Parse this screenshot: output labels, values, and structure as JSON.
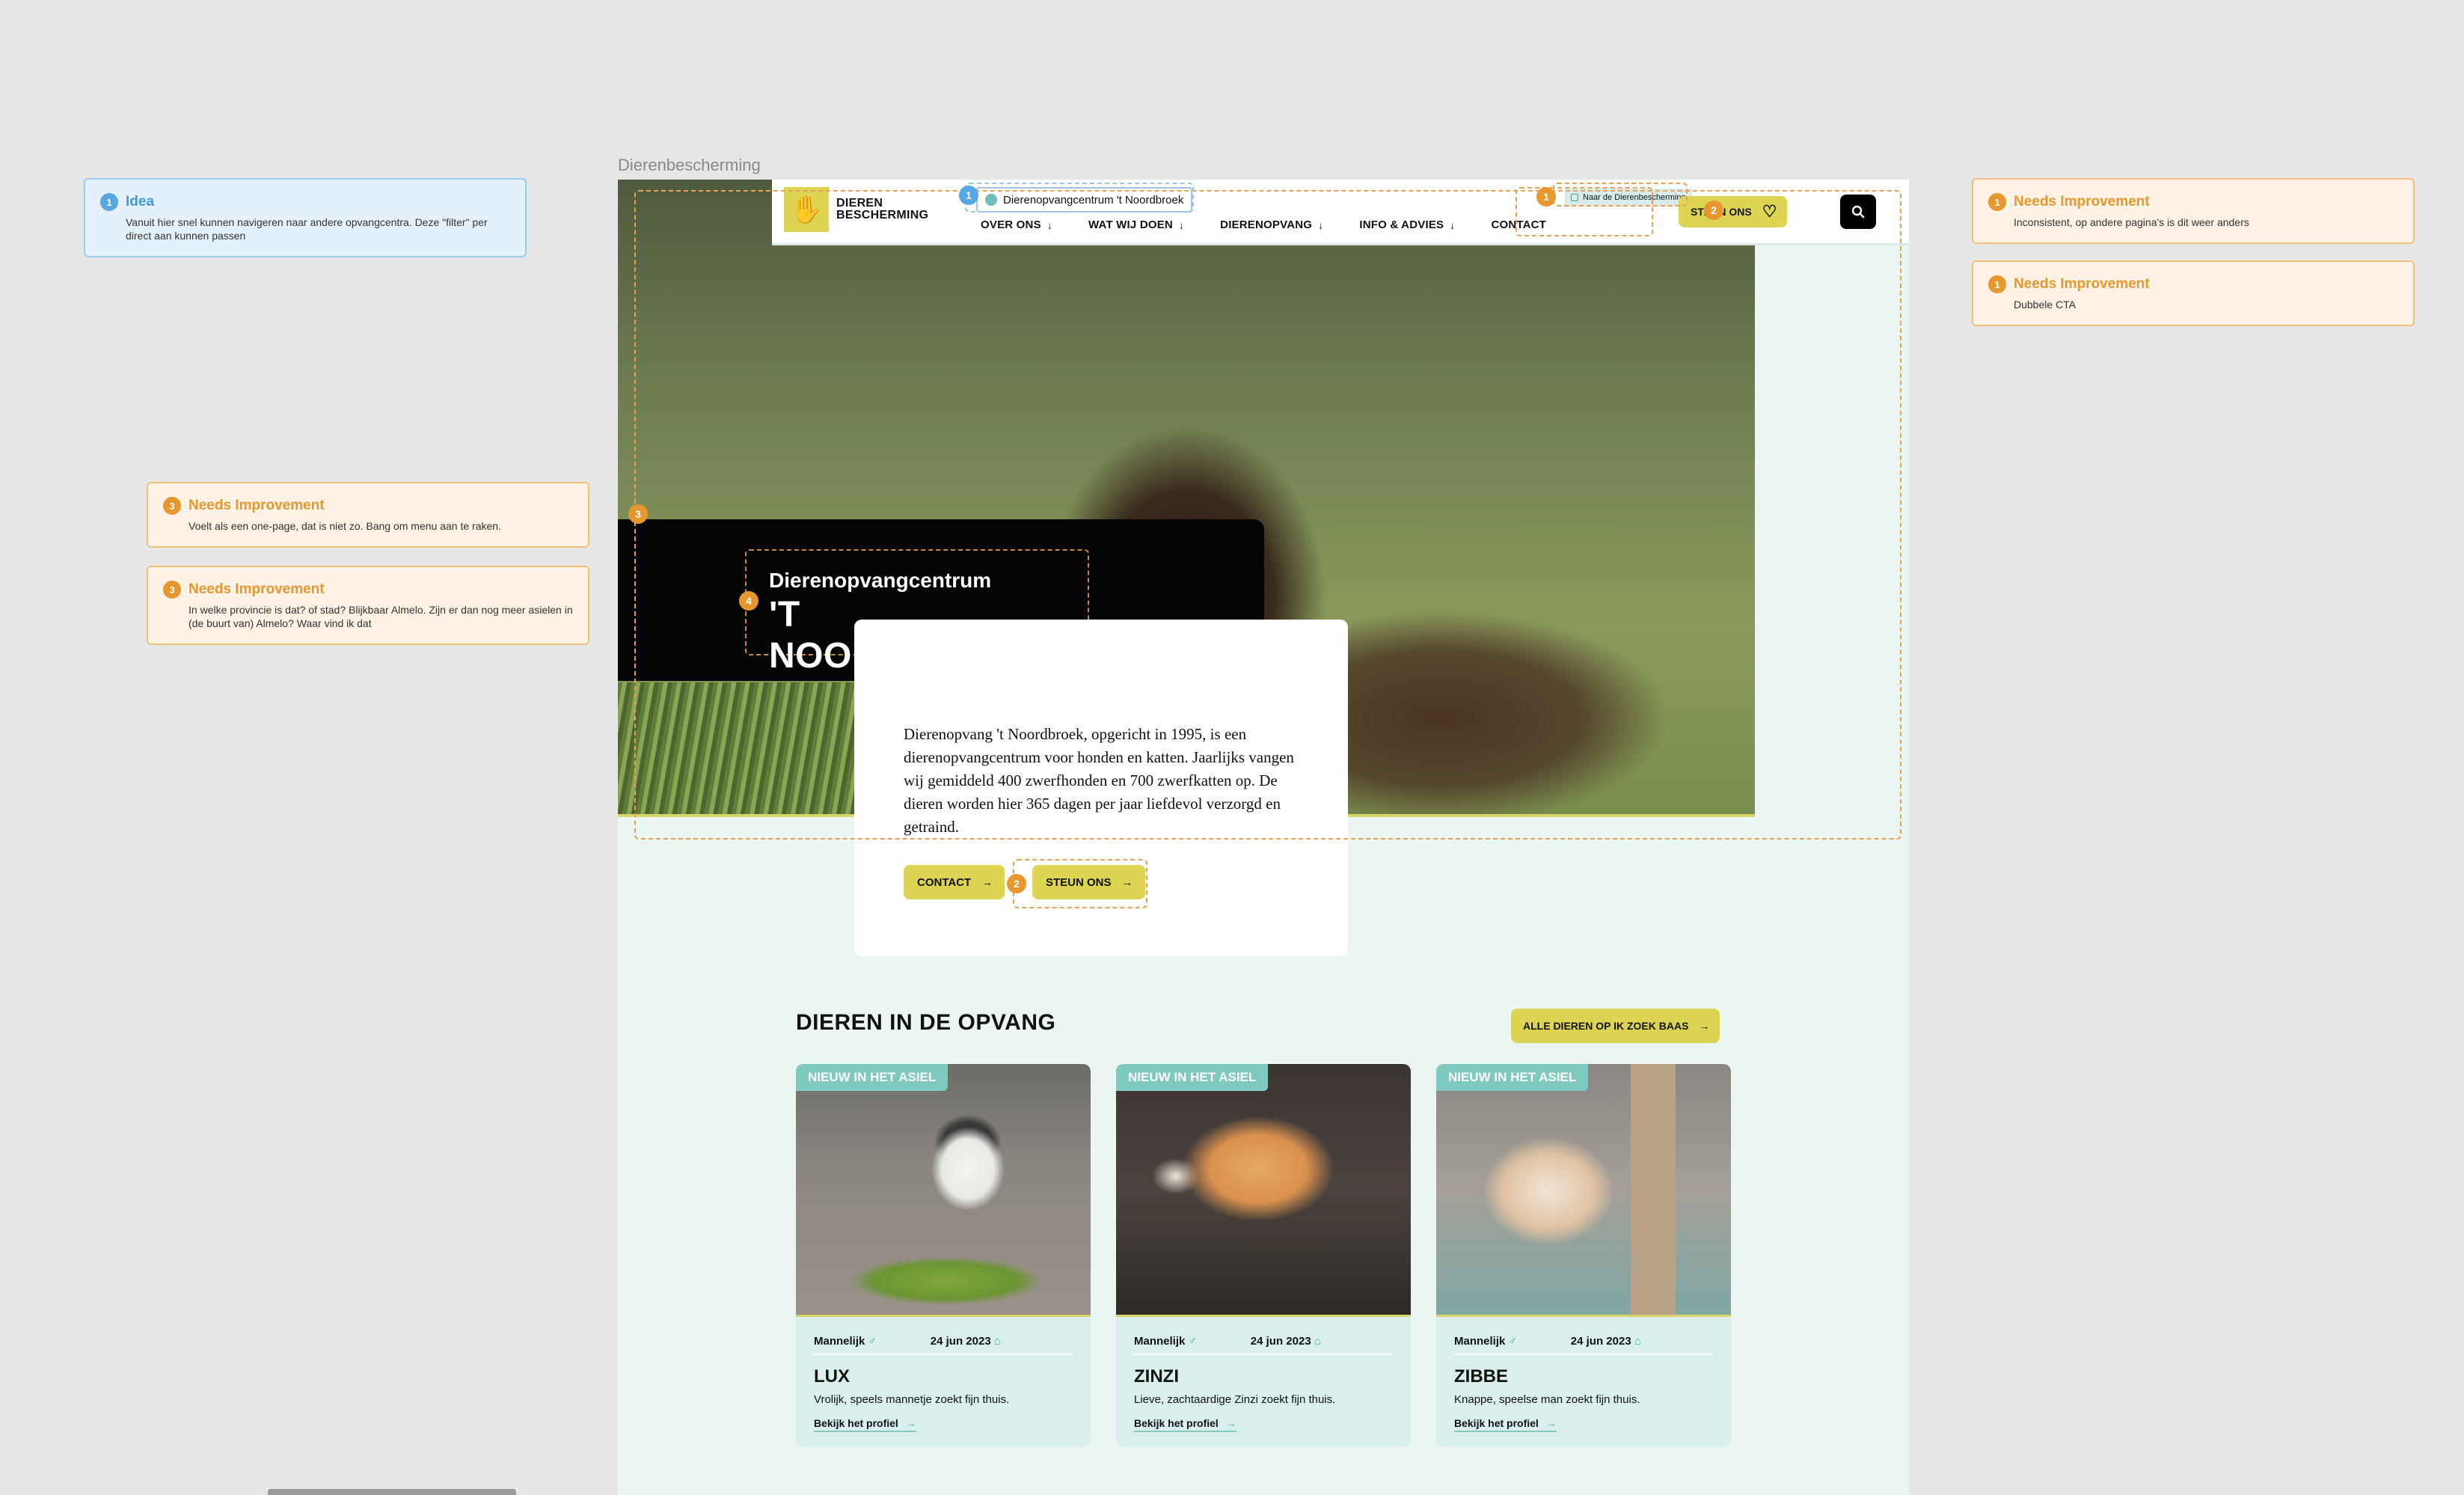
{
  "canvas": {
    "frame_label": "Dierenbescherming"
  },
  "header": {
    "logo_line1": "DIEREN",
    "logo_line2": "BESCHERMING",
    "shelter_selector": "Dierenopvangcentrum 't Noordbroek",
    "to_main_site": "Naar de Dierenbescherming",
    "nav": [
      {
        "label": "OVER ONS",
        "arrow": "↓"
      },
      {
        "label": "WAT WIJ DOEN",
        "arrow": "↓"
      },
      {
        "label": "DIERENOPVANG",
        "arrow": "↓"
      },
      {
        "label": "INFO & ADVIES",
        "arrow": "↓"
      },
      {
        "label": "CONTACT",
        "arrow": ""
      }
    ],
    "donate_label": "STEUN ONS",
    "search_icon": "search-icon"
  },
  "hero": {
    "kicker": "Dierenopvangcentrum",
    "title": "'T NOORDBROEK",
    "intro": "Dierenopvang 't Noordbroek, opgericht in 1995, is een dierenopvangcentrum voor honden en katten. Jaarlijks vangen wij gemiddeld 400 zwerfhonden en 700 zwerfkatten op. De dieren worden hier 365 dagen per jaar liefdevol verzorgd en getraind.",
    "contact_label": "CONTACT",
    "donate_label": "STEUN ONS"
  },
  "animals": {
    "title": "DIEREN IN DE OPVANG",
    "all_label": "ALLE DIEREN OP IK ZOEK BAAS",
    "cards": [
      {
        "badge": "NIEUW IN HET ASIEL",
        "gender": "Mannelijk",
        "gender_icon": "♂",
        "date": "24 jun 2023",
        "name": "LUX",
        "desc": "Vrolijk, speels mannetje zoekt fijn thuis.",
        "link": "Bekijk het profiel"
      },
      {
        "badge": "NIEUW IN HET ASIEL",
        "gender": "Mannelijk",
        "gender_icon": "♂",
        "date": "24 jun 2023",
        "name": "ZINZI",
        "desc": "Lieve, zachtaardige Zinzi zoekt fijn thuis.",
        "link": "Bekijk het profiel"
      },
      {
        "badge": "NIEUW IN HET ASIEL",
        "gender": "Mannelijk",
        "gender_icon": "♂",
        "date": "24 jun 2023",
        "name": "ZIBBE",
        "desc": "Knappe, speelse man zoekt fijn thuis.",
        "link": "Bekijk het profiel"
      }
    ]
  },
  "markers": {
    "m1": "1",
    "m2": "2",
    "m3": "3",
    "m4": "4"
  },
  "notes": [
    {
      "type": "Idea",
      "num": "1",
      "body": "Vanuit hier snel kunnen navigeren naar andere opvangcentra. Deze \"filter\" per direct aan kunnen passen"
    },
    {
      "type": "Needs Improvement",
      "num": "3",
      "body": "Voelt als een one-page, dat is niet zo. Bang om menu aan te raken."
    },
    {
      "type": "Needs Improvement",
      "num": "3",
      "body": "In welke provincie is dat? of stad? Blijkbaar Almelo. Zijn er dan nog meer asielen in (de buurt van) Almelo? Waar vind ik dat"
    },
    {
      "type": "Needs Improvement",
      "num": "1",
      "body": "Inconsistent, op andere pagina's is dit weer anders"
    },
    {
      "type": "Needs Improvement",
      "num": "1",
      "body": "Dubbele CTA"
    }
  ],
  "colors": {
    "accent_yellow": "#dcd452",
    "teal": "#7fc9bf",
    "page_bg": "#ebf6f3",
    "annotation_orange": "#e8972e",
    "annotation_blue": "#55a8e0"
  }
}
